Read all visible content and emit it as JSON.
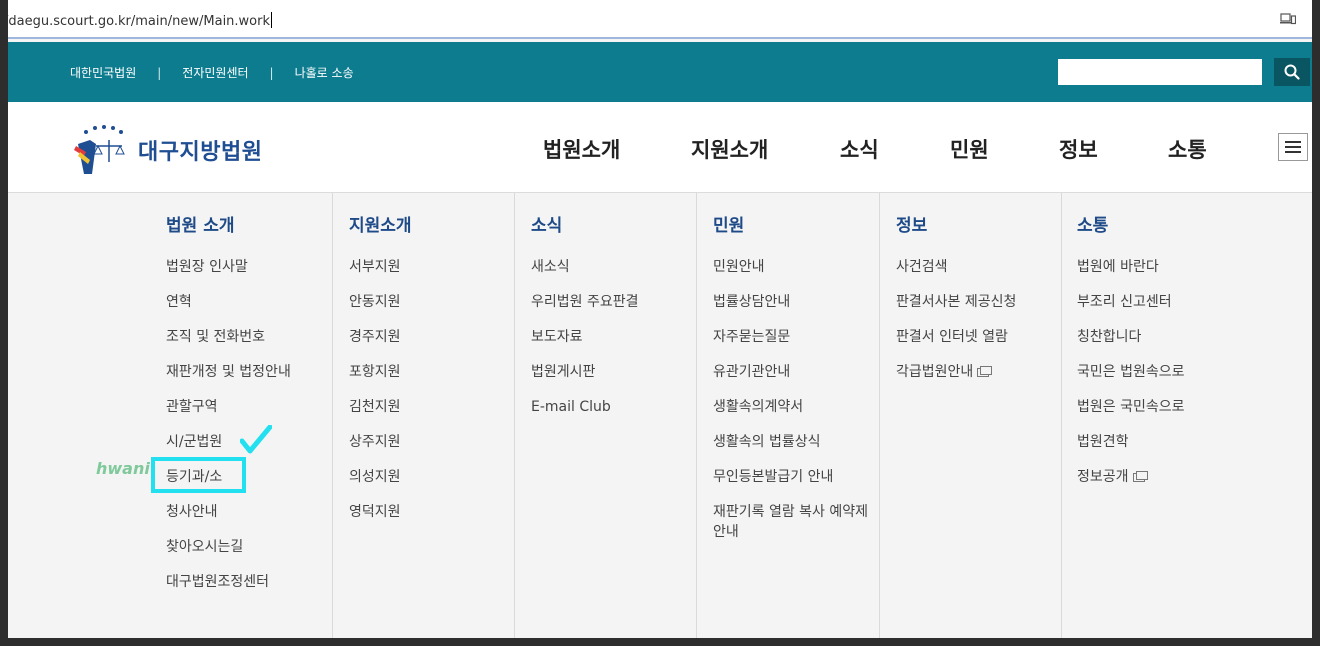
{
  "address_bar": {
    "url": "/daegu.scourt.go.kr/main/new/Main.work"
  },
  "util_bar": {
    "links": [
      "대한민국법원",
      "전자민원센터",
      "나홀로 소송"
    ],
    "separator": "|",
    "search_placeholder": "",
    "search_icon": "search-icon"
  },
  "header": {
    "logo_text": "대구지방법원",
    "nav": [
      "법원소개",
      "지원소개",
      "소식",
      "민원",
      "정보",
      "소통"
    ]
  },
  "mega_menu": {
    "columns": [
      {
        "title": "법원 소개",
        "items": [
          "법원장 인사말",
          "연혁",
          "조직 및 전화번호",
          "재판개정 및 법정안내",
          "관할구역",
          "시/군법원",
          "등기과/소",
          "청사안내",
          "찾아오시는길",
          "대구법원조정센터"
        ]
      },
      {
        "title": "지원소개",
        "items": [
          "서부지원",
          "안동지원",
          "경주지원",
          "포항지원",
          "김천지원",
          "상주지원",
          "의성지원",
          "영덕지원"
        ]
      },
      {
        "title": "소식",
        "items": [
          "새소식",
          "우리법원 주요판결",
          "보도자료",
          "법원게시판",
          "E-mail Club"
        ]
      },
      {
        "title": "민원",
        "items": [
          "민원안내",
          "법률상담안내",
          "자주묻는질문",
          "유관기관안내",
          "생활속의계약서",
          "생활속의 법률상식",
          "무인등본발급기 안내",
          "재판기록 열람 복사 예약제 안내"
        ]
      },
      {
        "title": "정보",
        "items": [
          "사건검색",
          "판결서사본 제공신청",
          "판결서 인터넷 열람",
          "각급법원안내"
        ]
      },
      {
        "title": "소통",
        "items": [
          "법원에 바란다",
          "부조리 신고센터",
          "칭찬합니다",
          "국민은 법원속으로",
          "법원은 국민속으로",
          "법원견학",
          "정보공개"
        ]
      }
    ]
  },
  "annotation": {
    "watermark": "hwani"
  },
  "colors": {
    "teal": "#0d7c8f",
    "navy_title": "#1e4a88",
    "highlight": "#22e0f0"
  }
}
